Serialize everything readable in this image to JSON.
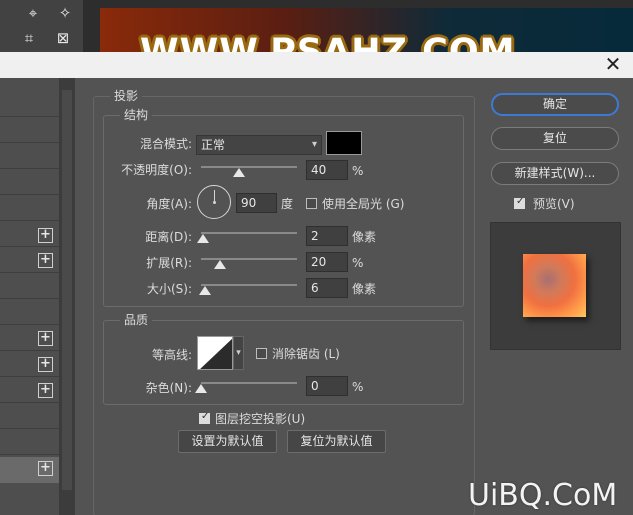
{
  "watermark": {
    "top": "WWW.PSAHZ.COM",
    "bottom": "UiBQ.CoM"
  },
  "toolbar_icons": [
    "slice-select-icon",
    "magic-wand-icon",
    "crop-icon",
    "frame-icon"
  ],
  "dialog": {
    "close_glyph": "✕"
  },
  "section": {
    "title": "投影",
    "structure": {
      "title": "结构",
      "blend_mode": {
        "label": "混合模式:",
        "value": "正常",
        "color": "#000000"
      },
      "opacity": {
        "label": "不透明度(O):",
        "value": "40",
        "unit": "%",
        "slider": 0.4
      },
      "angle": {
        "label": "角度(A):",
        "value": "90",
        "unit": "度",
        "use_global_label": "使用全局光 (G)",
        "use_global": false
      },
      "distance": {
        "label": "距离(D):",
        "value": "2",
        "unit": "像素",
        "slider": 0.02
      },
      "spread": {
        "label": "扩展(R):",
        "value": "20",
        "unit": "%",
        "slider": 0.2
      },
      "size": {
        "label": "大小(S):",
        "value": "6",
        "unit": "像素",
        "slider": 0.04
      }
    },
    "quality": {
      "title": "品质",
      "contour_label": "等高线:",
      "anti_alias_label": "消除锯齿 (L)",
      "anti_alias": false,
      "noise": {
        "label": "杂色(N):",
        "value": "0",
        "unit": "%",
        "slider": 0.0
      }
    },
    "knockout_label": "图层挖空投影(U)",
    "knockout": true,
    "set_default": "设置为默认值",
    "reset_default": "复位为默认值"
  },
  "buttons": {
    "ok": "确定",
    "reset": "复位",
    "new_style": "新建样式(W)..."
  },
  "preview": {
    "label": "预览(V)",
    "checked": true
  },
  "left_list": {
    "plus_glyph": "+"
  }
}
